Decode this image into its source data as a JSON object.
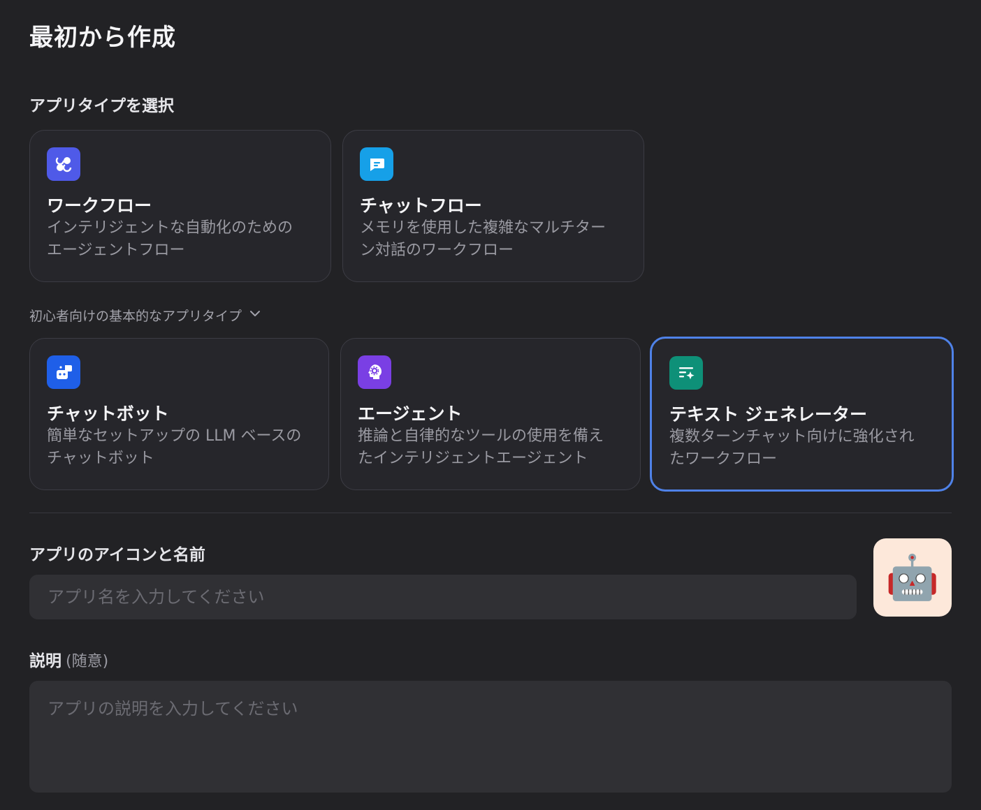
{
  "page": {
    "title": "最初から作成"
  },
  "app_type": {
    "label": "アプリタイプを選択",
    "primary_cards": [
      {
        "title": "ワークフロー",
        "desc": "インテリジェントな自動化のためのエージェントフロー",
        "icon": "workflow-icon",
        "icon_color": "#4f5ae8"
      },
      {
        "title": "チャットフロー",
        "desc": "メモリを使用した複雑なマルチターン対話のワークフロー",
        "icon": "chatflow-icon",
        "icon_color": "#16a0e8"
      }
    ],
    "beginner_toggle": "初心者向けの基本的なアプリタイプ",
    "basic_cards": [
      {
        "title": "チャットボット",
        "desc": "簡単なセットアップの LLM ベースのチャットボット",
        "icon": "chatbot-icon",
        "icon_color": "#1f5fe8"
      },
      {
        "title": "エージェント",
        "desc": "推論と自律的なツールの使用を備えたインテリジェントエージェント",
        "icon": "agent-icon",
        "icon_color": "#7a3fe4"
      },
      {
        "title": "テキスト ジェネレーター",
        "desc": "複数ターンチャット向けに強化されたワークフロー",
        "icon": "text-generator-icon",
        "icon_color": "#0e9078",
        "selected": true
      }
    ]
  },
  "name_section": {
    "label": "アプリのアイコンと名前",
    "placeholder": "アプリ名を入力してください",
    "value": "",
    "app_icon": "🤖",
    "app_icon_bg": "#fde8da"
  },
  "description_section": {
    "label": "説明",
    "optional": "(随意)",
    "placeholder": "アプリの説明を入力してください",
    "value": ""
  },
  "colors": {
    "accent": "#4f82e8",
    "background": "#222225",
    "card": "#26262b"
  }
}
